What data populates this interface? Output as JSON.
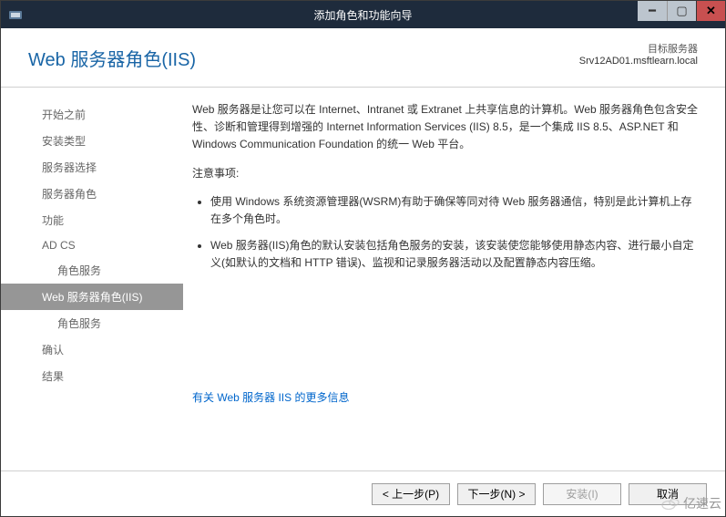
{
  "window": {
    "title": "添加角色和功能向导"
  },
  "header": {
    "title": "Web 服务器角色(IIS)",
    "target_label": "目标服务器",
    "target_server": "Srv12AD01.msftlearn.local"
  },
  "sidebar": {
    "items": [
      {
        "label": "开始之前",
        "selected": false,
        "sub": false
      },
      {
        "label": "安装类型",
        "selected": false,
        "sub": false
      },
      {
        "label": "服务器选择",
        "selected": false,
        "sub": false
      },
      {
        "label": "服务器角色",
        "selected": false,
        "sub": false
      },
      {
        "label": "功能",
        "selected": false,
        "sub": false
      },
      {
        "label": "AD CS",
        "selected": false,
        "sub": false
      },
      {
        "label": "角色服务",
        "selected": false,
        "sub": true
      },
      {
        "label": "Web 服务器角色(IIS)",
        "selected": true,
        "sub": false
      },
      {
        "label": "角色服务",
        "selected": false,
        "sub": true
      },
      {
        "label": "确认",
        "selected": false,
        "sub": false
      },
      {
        "label": "结果",
        "selected": false,
        "sub": false
      }
    ]
  },
  "content": {
    "intro": "Web 服务器是让您可以在 Internet、Intranet 或 Extranet 上共享信息的计算机。Web 服务器角色包含安全性、诊断和管理得到增强的 Internet Information Services (IIS) 8.5，是一个集成 IIS 8.5、ASP.NET 和 Windows Communication Foundation 的统一 Web 平台。",
    "notes_title": "注意事项:",
    "bullets": [
      "使用 Windows 系统资源管理器(WSRM)有助于确保等同对待 Web 服务器通信，特别是此计算机上存在多个角色时。",
      "Web 服务器(IIS)角色的默认安装包括角色服务的安装，该安装使您能够使用静态内容、进行最小自定义(如默认的文档和 HTTP 错误)、监视和记录服务器活动以及配置静态内容压缩。"
    ],
    "more_link": "有关 Web 服务器 IIS 的更多信息"
  },
  "footer": {
    "previous": "< 上一步(P)",
    "next": "下一步(N) >",
    "install": "安装(I)",
    "cancel": "取消"
  },
  "watermark": "亿速云"
}
